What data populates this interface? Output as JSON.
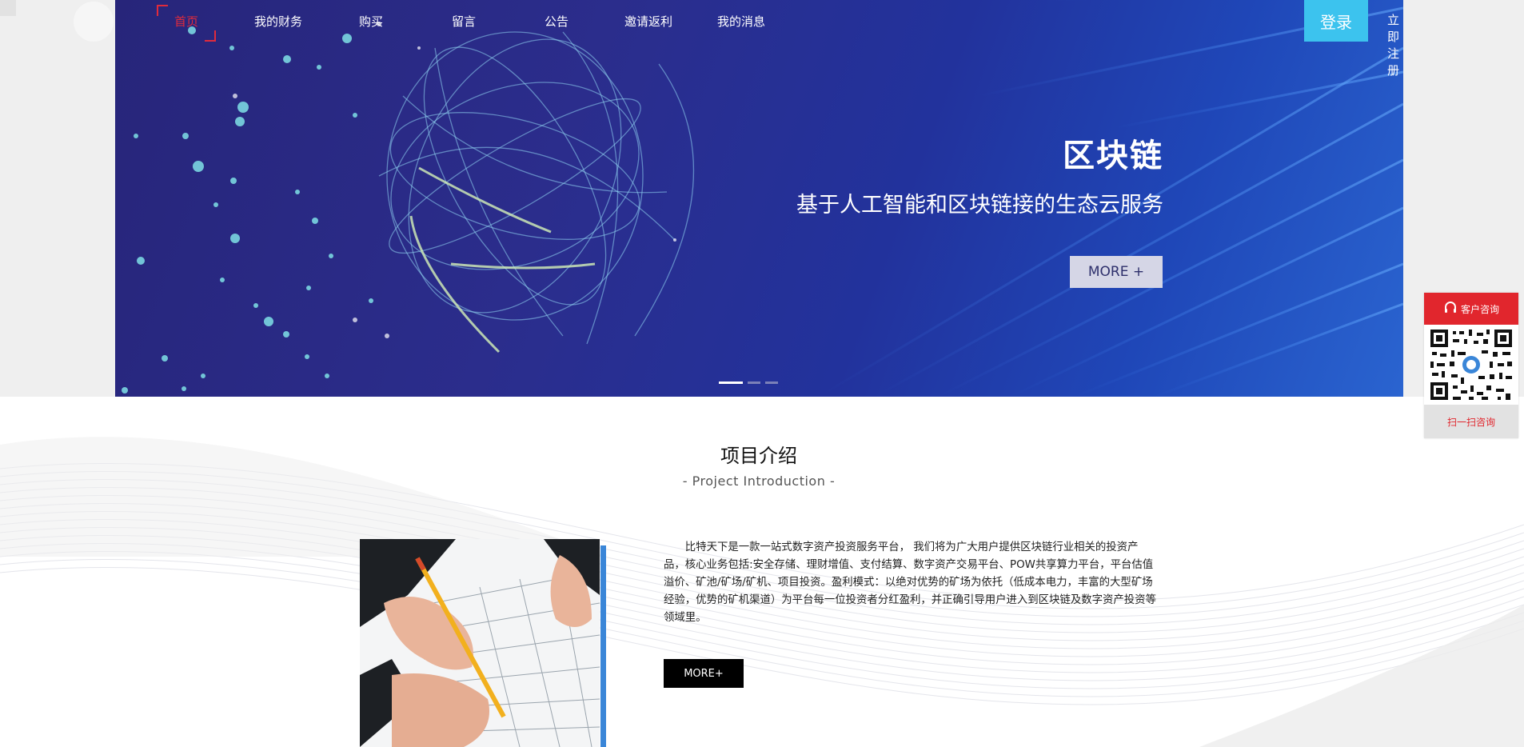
{
  "nav": {
    "items": [
      {
        "label": "首页",
        "active": true
      },
      {
        "label": "我的财务"
      },
      {
        "label": "购买"
      },
      {
        "label": "留言"
      },
      {
        "label": "公告"
      },
      {
        "label": "邀请返利"
      },
      {
        "label": "我的消息"
      }
    ],
    "login_label": "登录",
    "register_label": "立即注册"
  },
  "hero": {
    "title": "区块链",
    "subtitle": "基于人工智能和区块链接的生态云服务",
    "more_label": "MORE +",
    "slides_count": 3,
    "active_slide": 1
  },
  "project": {
    "title": "项目介绍",
    "subtitle": "- Project Introduction -",
    "body": "比特天下是一款一站式数字资产投资服务平台， 我们将为广大用户提供区块链行业相关的投资产品，核心业务包括:安全存储、理财增值、支付结算、数字资产交易平台、POW共享算力平台，平台估值溢价、矿池/矿场/矿机、项目投资。盈利模式：以绝对优势的矿场为依托（低成本电力，丰富的大型矿场经验，优势的矿机渠道）为平台每一位投资者分红盈利，并正确引导用户进入到区块链及数字资产投资等领域里。",
    "more_label": "MORE+"
  },
  "consult": {
    "head_label": "客户咨询",
    "foot_label": "扫一扫咨询"
  },
  "colors": {
    "accent_red": "#e1262d",
    "login_cyan": "#3cc3ee",
    "hero_blue": "#2b2d8c",
    "photo_bar": "#3a86d8"
  }
}
